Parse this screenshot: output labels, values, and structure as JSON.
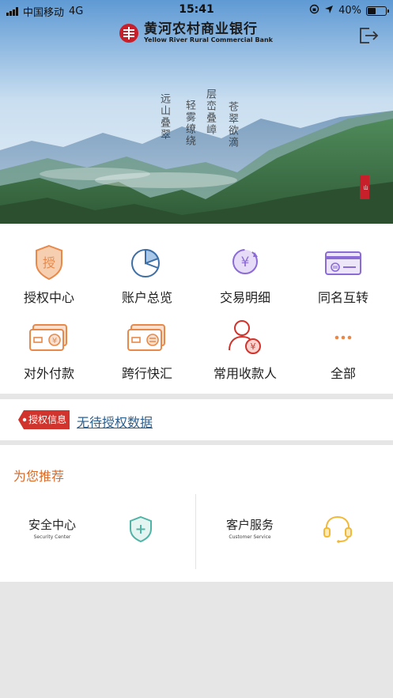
{
  "status_bar": {
    "carrier": "中国移动",
    "network": "4G",
    "time": "15:41",
    "battery": "40%",
    "battery_level": 0.4
  },
  "brand": {
    "name_cn": "黄河农村商业银行",
    "name_en": "Yellow River Rural Commercial Bank"
  },
  "menu": [
    {
      "label": "授权中心",
      "icon": "authorize-icon"
    },
    {
      "label": "账户总览",
      "icon": "pie-chart-icon"
    },
    {
      "label": "交易明细",
      "icon": "yuan-refresh-icon"
    },
    {
      "label": "同名互转",
      "icon": "card-transfer-icon"
    },
    {
      "label": "对外付款",
      "icon": "card-yuan-icon"
    },
    {
      "label": "跨行快汇",
      "icon": "card-exchange-icon"
    },
    {
      "label": "常用收款人",
      "icon": "payee-icon"
    },
    {
      "label": "全部",
      "icon": "more-icon"
    }
  ],
  "auth": {
    "tag": "授权信息",
    "text": "无待授权数据"
  },
  "recommend": {
    "title": "为您推荐",
    "items": [
      {
        "cn": "安全中心",
        "en": "Security Center",
        "icon": "shield-icon"
      },
      {
        "cn": "客户服务",
        "en": "Customer Service",
        "icon": "headset-icon"
      }
    ]
  },
  "colors": {
    "accent_orange": "#e8894a",
    "accent_red": "#d0342c",
    "link_blue": "#2b5f8f",
    "teal": "#4fb3a5",
    "purple": "#8b6bd6"
  }
}
